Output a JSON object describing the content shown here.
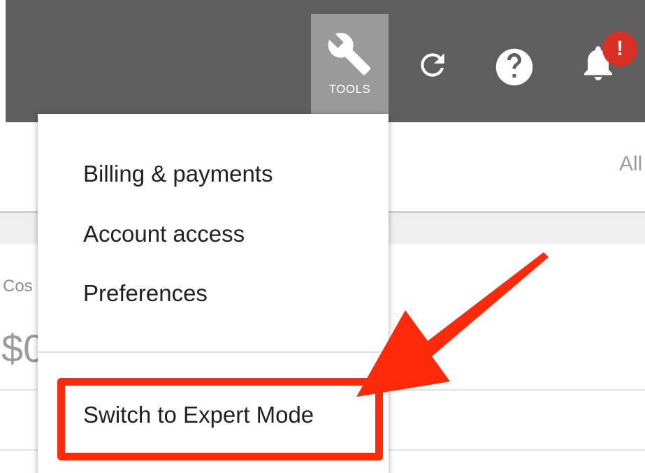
{
  "header": {
    "tools_label": "TOOLS",
    "alert_badge": "!"
  },
  "dropdown": {
    "items": [
      {
        "label": "Billing & payments"
      },
      {
        "label": "Account access"
      },
      {
        "label": "Preferences"
      },
      {
        "label": "Switch to Expert Mode"
      }
    ]
  },
  "background": {
    "all_label": "All",
    "cost_label": "Cos",
    "amount_value": "$0"
  },
  "colors": {
    "header_bg": "#5f5f5f",
    "tools_bg": "#9a9a9a",
    "badge": "#d93025",
    "annotation": "#ff2a0a"
  },
  "icons": {
    "tools": "wrench-icon",
    "refresh": "refresh-icon",
    "help": "help-icon",
    "notifications": "bell-icon"
  }
}
